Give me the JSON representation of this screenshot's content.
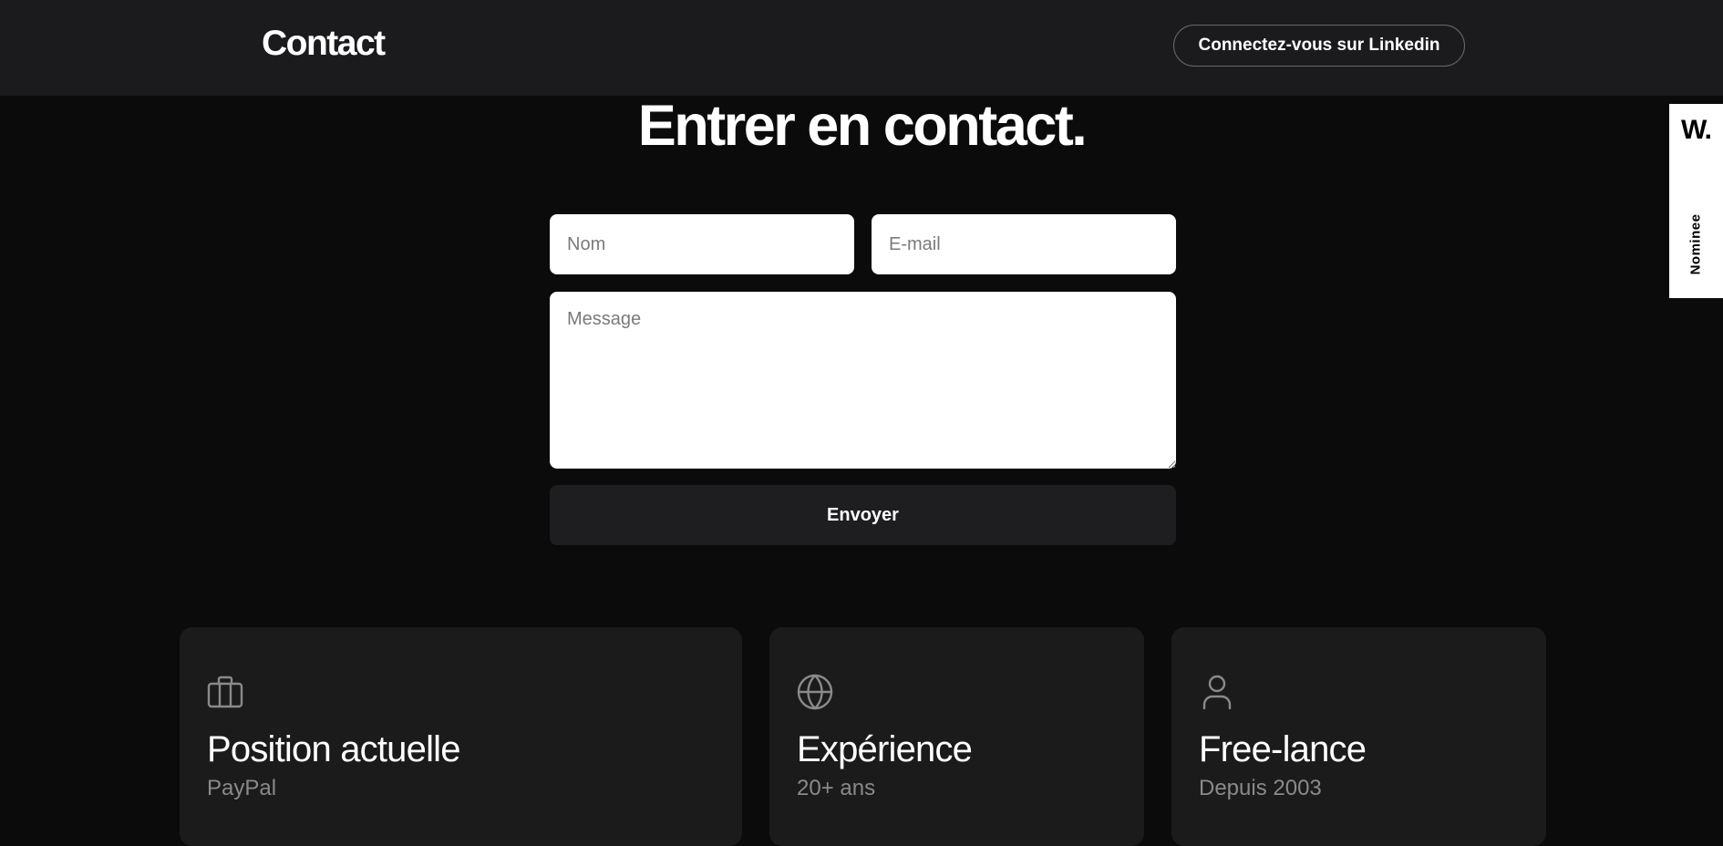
{
  "header": {
    "title": "Contact",
    "linkedin_button": "Connectez-vous sur Linkedin"
  },
  "hero": {
    "headline": "Entrer en contact."
  },
  "form": {
    "name_placeholder": "Nom",
    "email_placeholder": "E-mail",
    "message_placeholder": "Message",
    "submit_label": "Envoyer"
  },
  "cards": [
    {
      "icon": "briefcase-icon",
      "title": "Position actuelle",
      "subtitle": "PayPal"
    },
    {
      "icon": "globe-icon",
      "title": "Expérience",
      "subtitle": "20+ ans"
    },
    {
      "icon": "user-icon",
      "title": "Free-lance",
      "subtitle": "Depuis 2003"
    }
  ],
  "award_badge": {
    "logo": "W.",
    "label": "Nominee"
  },
  "colors": {
    "page_background": "#0b0b0b",
    "header_background": "#1b1b1d",
    "card_background": "#1b1b1b",
    "button_background": "#1e1e20",
    "muted_text": "#8a8a8a",
    "icon_color": "#8a8a8a"
  }
}
